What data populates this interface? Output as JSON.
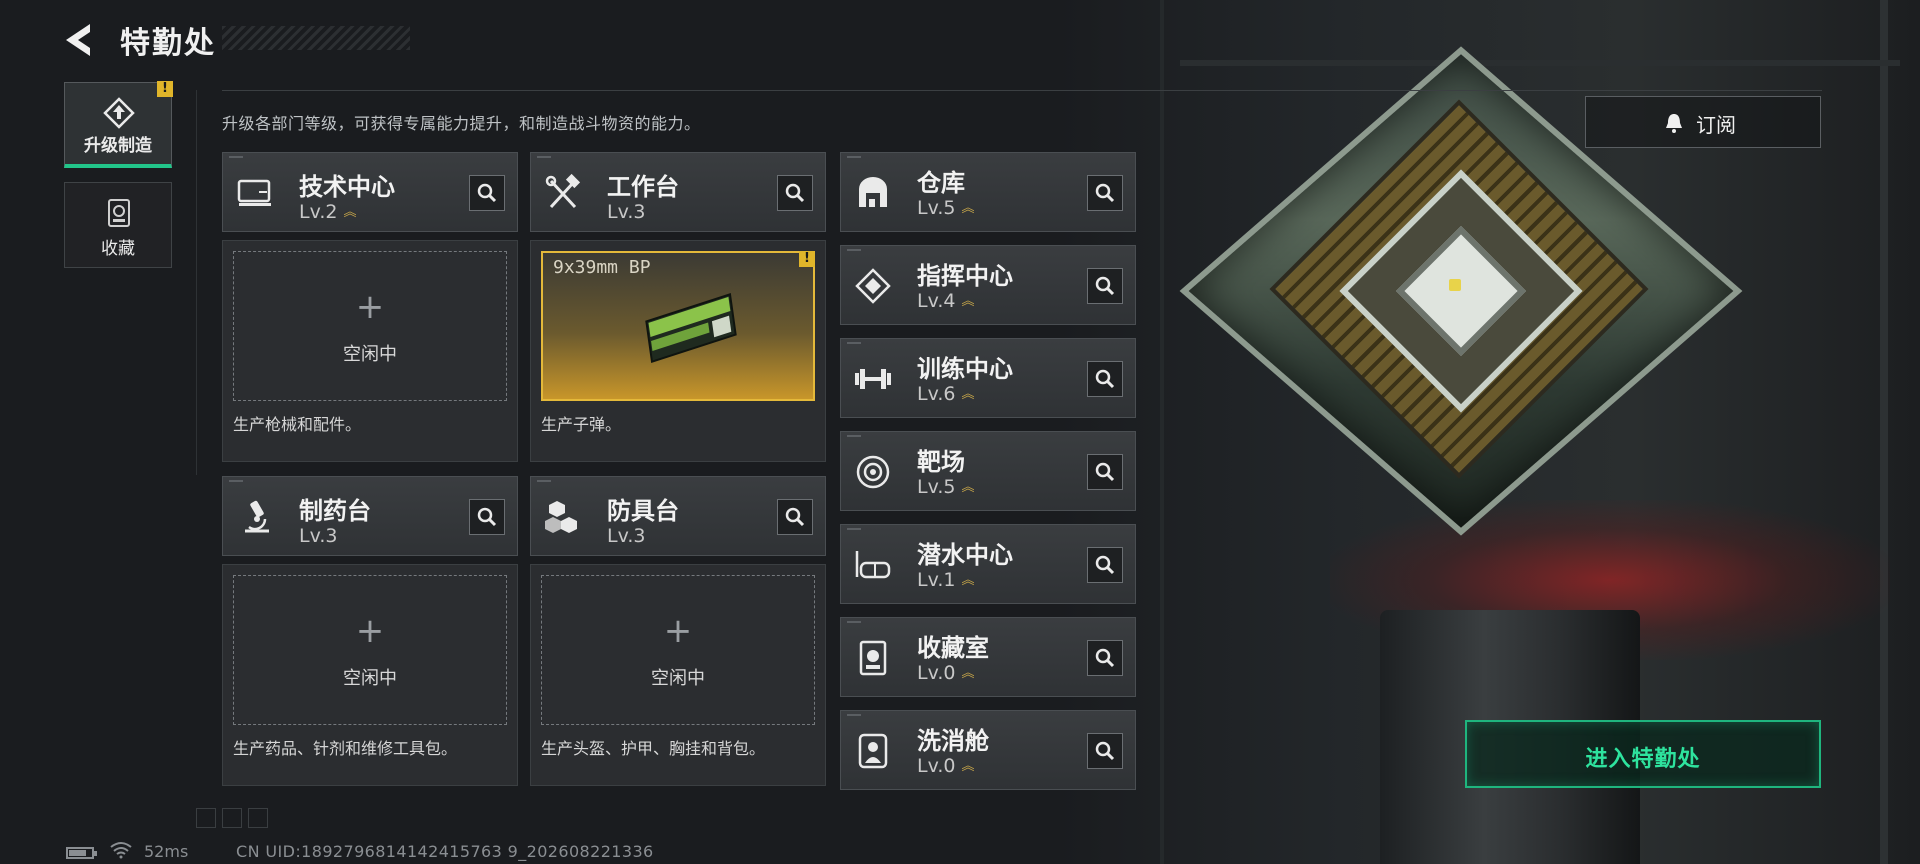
{
  "header": {
    "title": "特勤处"
  },
  "side_nav": [
    {
      "label": "升级制造",
      "active": true,
      "badge": "!"
    },
    {
      "label": "收藏",
      "active": false
    }
  ],
  "description": "升级各部门等级，可获得专属能力提升，和制造战斗物资的能力。",
  "production_cards": [
    {
      "name": "技术中心",
      "level": "Lv.2",
      "upgradable": true,
      "slot": {
        "plus": "+",
        "status": "空闲中"
      },
      "produce": "生产枪械和配件。"
    },
    {
      "name": "工作台",
      "level": "Lv.3",
      "upgradable": false,
      "slot": {
        "item_name": "9x39mm BP",
        "badge": "!"
      },
      "produce": "生产子弹。"
    },
    {
      "name": "制药台",
      "level": "Lv.3",
      "upgradable": false,
      "slot": {
        "plus": "+",
        "status": "空闲中"
      },
      "produce": "生产药品、针剂和维修工具包。"
    },
    {
      "name": "防具台",
      "level": "Lv.3",
      "upgradable": false,
      "slot": {
        "plus": "+",
        "status": "空闲中"
      },
      "produce": "生产头盔、护甲、胸挂和背包。"
    }
  ],
  "departments": [
    {
      "name": "仓库",
      "level": "Lv.5",
      "icon": "warehouse-icon"
    },
    {
      "name": "指挥中心",
      "level": "Lv.4",
      "icon": "command-center-icon"
    },
    {
      "name": "训练中心",
      "level": "Lv.6",
      "icon": "dumbbell-icon"
    },
    {
      "name": "靶场",
      "level": "Lv.5",
      "icon": "target-icon"
    },
    {
      "name": "潜水中心",
      "level": "Lv.1",
      "icon": "diving-mask-icon"
    },
    {
      "name": "收藏室",
      "level": "Lv.0",
      "icon": "collection-room-icon"
    },
    {
      "name": "洗消舱",
      "level": "Lv.0",
      "icon": "decontamination-icon"
    }
  ],
  "subscribe_button": {
    "label": "订阅"
  },
  "enter_button": {
    "label": "进入特勤处"
  },
  "footer": {
    "ping": "52ms",
    "uid": "CN UID:1892796814142415763 9_202608221336",
    "battery_level": 0.75
  },
  "colors": {
    "accent_green": "#22c58a",
    "upgrade_gold": "#c9a84a",
    "warning_yellow": "#e0b52a"
  }
}
